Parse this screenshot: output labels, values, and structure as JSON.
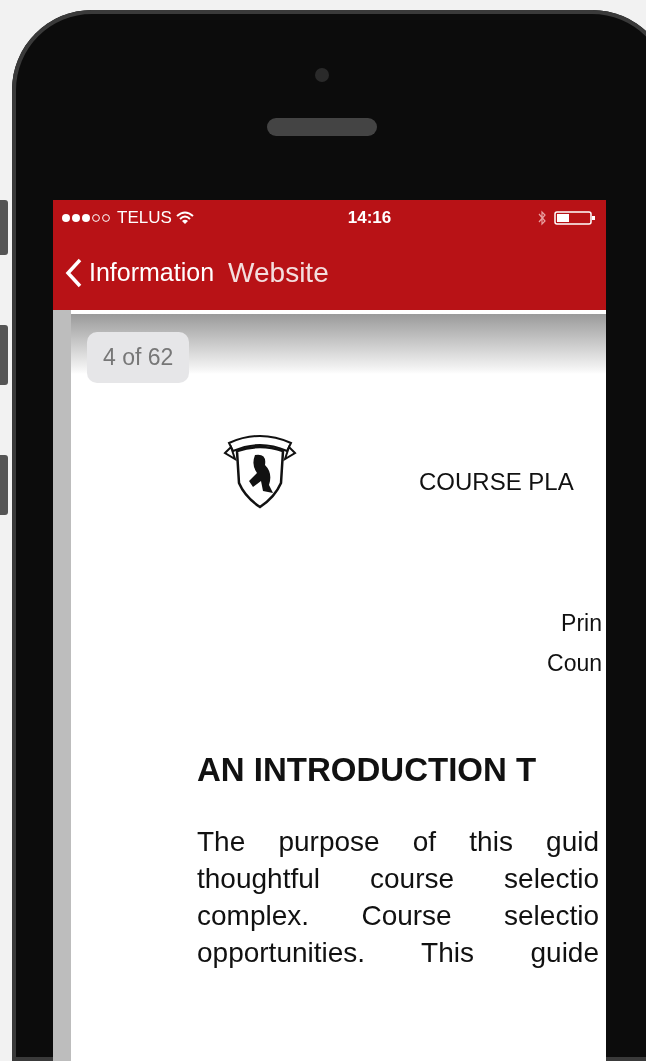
{
  "status_bar": {
    "carrier": "TELUS",
    "time": "14:16"
  },
  "nav_bar": {
    "back_label": "Information",
    "title": "Website"
  },
  "document": {
    "page_indicator": "4 of 62",
    "title": "COURSE PLA",
    "subtitle_lines": [
      "Prin",
      "Coun"
    ],
    "heading": "AN INTRODUCTION T",
    "paragraph_lines": [
      "The purpose of this guid",
      "thoughtful course selectio",
      "complex. Course selectio",
      "opportunities. This guide"
    ]
  }
}
